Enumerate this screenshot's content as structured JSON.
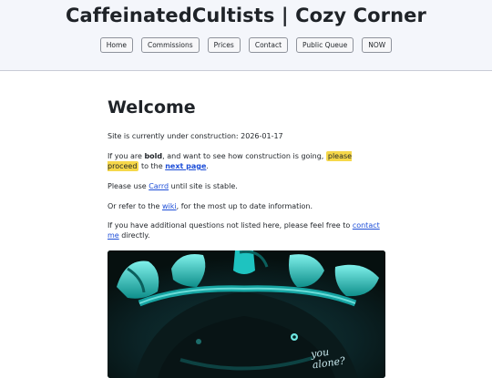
{
  "header": {
    "title": "CaffeinatedCultists | Cozy Corner",
    "nav": [
      "Home",
      "Commissions",
      "Prices",
      "Contact",
      "Public Queue",
      "NOW"
    ]
  },
  "main": {
    "heading": "Welcome",
    "p1": "Site is currently under construction: 2026-01-17",
    "p2": {
      "a": "If you are ",
      "bold": "bold",
      "b": ", and want to see how construction is going, ",
      "highlight": "please proceed",
      "c": " to the ",
      "link": "next page",
      "d": "."
    },
    "p3": {
      "a": "Please use ",
      "link": "Carrd",
      "b": " until site is stable."
    },
    "p4": {
      "a": "Or refer to the ",
      "link": "wiki",
      "b": ", for the most up to date information."
    },
    "p5": {
      "a": "If you have additional questions not listed here, please feel free to ",
      "link": "contact me",
      "b": " directly."
    },
    "artwork": {
      "caption_line1": "you",
      "caption_line2": "alone?"
    }
  },
  "colors": {
    "header_bg": "#f4f6fb",
    "link": "#1d4ed8",
    "highlight": "#f6d84a",
    "art_teal": "#1ec3c0"
  }
}
